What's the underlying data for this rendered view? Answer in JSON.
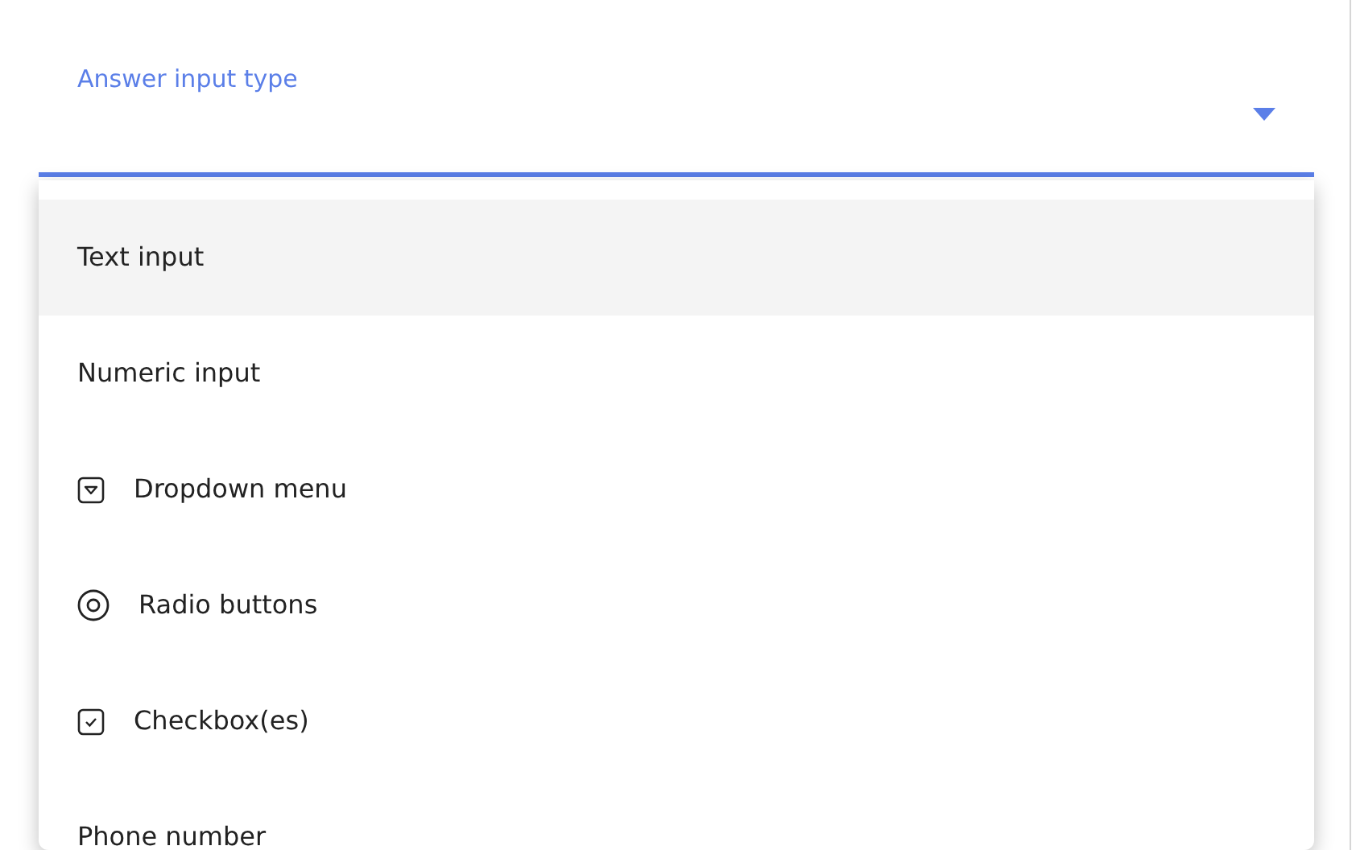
{
  "field": {
    "label": "Answer input type",
    "expanded": true
  },
  "menu": {
    "items": [
      {
        "label": "Text input",
        "kind": "plain",
        "selected": true
      },
      {
        "label": "Numeric input",
        "kind": "plain",
        "selected": false
      },
      {
        "label": "Dropdown menu",
        "kind": "dropdown",
        "selected": false
      },
      {
        "label": "Radio buttons",
        "kind": "radio",
        "selected": false
      },
      {
        "label": "Checkbox(es)",
        "kind": "checkbox",
        "selected": false
      },
      {
        "label": "Phone number",
        "kind": "plain",
        "selected": false
      }
    ]
  }
}
